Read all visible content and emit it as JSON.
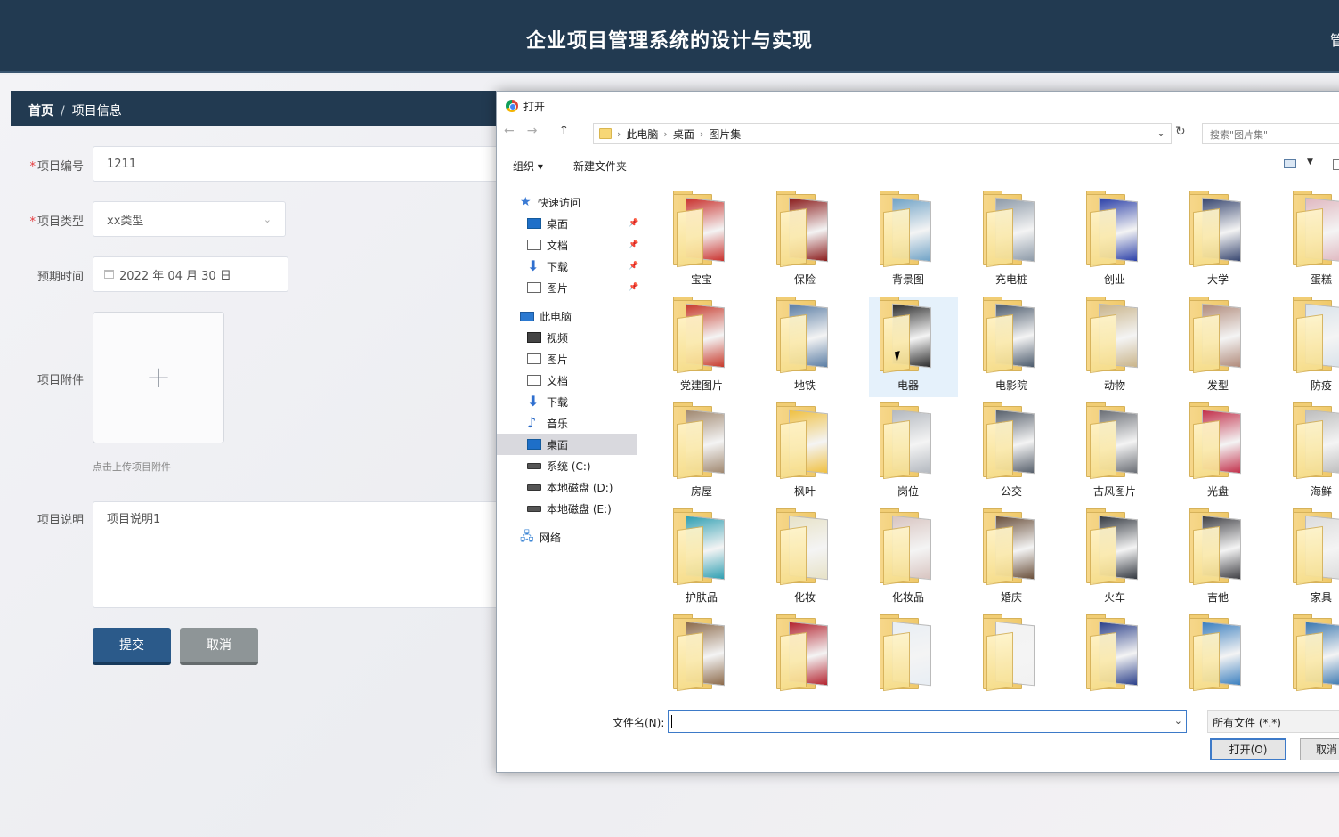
{
  "app": {
    "title": "企业项目管理系统的设计与实现",
    "user_partial": "管"
  },
  "breadcrumb": {
    "home": "首页",
    "separator": "/",
    "current": "项目信息"
  },
  "form": {
    "project_no_label": "项目编号",
    "project_no_value": "1211",
    "project_type_label": "项目类型",
    "project_type_value": "xx类型",
    "expected_time_label": "预期时间",
    "expected_time_value": "2022 年 04 月 30 日",
    "attachment_label": "项目附件",
    "attachment_hint": "点击上传项目附件",
    "desc_label": "项目说明",
    "desc_value": "项目说明1",
    "submit_label": "提交",
    "cancel_label": "取消",
    "required_mark": "*",
    "plus": "+"
  },
  "dialog": {
    "title": "打开",
    "back": "←",
    "forward": "→",
    "up": "↑",
    "path": [
      "此电脑",
      "桌面",
      "图片集"
    ],
    "path_sep": "›",
    "dropdown_arrow": "⌄",
    "refresh": "↻",
    "search_placeholder": "搜索\"图片集\"",
    "organize": "组织 ▾",
    "new_folder": "新建文件夹",
    "pin": "📌",
    "tree": [
      {
        "label": "快速访问",
        "icon": "star-icon"
      },
      {
        "label": "桌面",
        "icon": "desktop-icon",
        "pinned": true
      },
      {
        "label": "文档",
        "icon": "document-icon",
        "pinned": true
      },
      {
        "label": "下载",
        "icon": "download-icon",
        "pinned": true
      },
      {
        "label": "图片",
        "icon": "pictures-icon",
        "pinned": true
      },
      {
        "label": "此电脑",
        "icon": "computer-icon"
      },
      {
        "label": "视频",
        "icon": "video-icon"
      },
      {
        "label": "图片",
        "icon": "pictures-icon"
      },
      {
        "label": "文档",
        "icon": "document-icon"
      },
      {
        "label": "下载",
        "icon": "download-icon"
      },
      {
        "label": "音乐",
        "icon": "music-icon"
      },
      {
        "label": "桌面",
        "icon": "desktop-icon",
        "selected": true
      },
      {
        "label": "系统 (C:)",
        "icon": "drive-icon"
      },
      {
        "label": "本地磁盘 (D:)",
        "icon": "drive-icon"
      },
      {
        "label": "本地磁盘 (E:)",
        "icon": "drive-icon"
      },
      {
        "label": "网络",
        "icon": "network-icon"
      }
    ],
    "folders": [
      [
        "宝宝",
        "保险",
        "背景图",
        "充电桩",
        "创业",
        "大学",
        "蛋糕"
      ],
      [
        "党建图片",
        "地铁",
        "电器",
        "电影院",
        "动物",
        "发型",
        "防疫"
      ],
      [
        "房屋",
        "枫叶",
        "岗位",
        "公交",
        "古风图片",
        "光盘",
        "海鲜"
      ],
      [
        "护肤品",
        "化妆",
        "化妆品",
        "婚庆",
        "火车",
        "吉他",
        "家具"
      ],
      [
        "",
        "",
        "",
        "",
        "",
        "",
        ""
      ]
    ],
    "filename_label": "文件名(N):",
    "filename_value": "",
    "filetype_value": "所有文件 (*.*)",
    "open_button": "打开(O)",
    "cancel_button": "取消"
  },
  "colors": {
    "header": "#223a51",
    "primary_button": "#2b5a8a",
    "secondary_button": "#8e9597",
    "accent": "#3d7ac8"
  }
}
